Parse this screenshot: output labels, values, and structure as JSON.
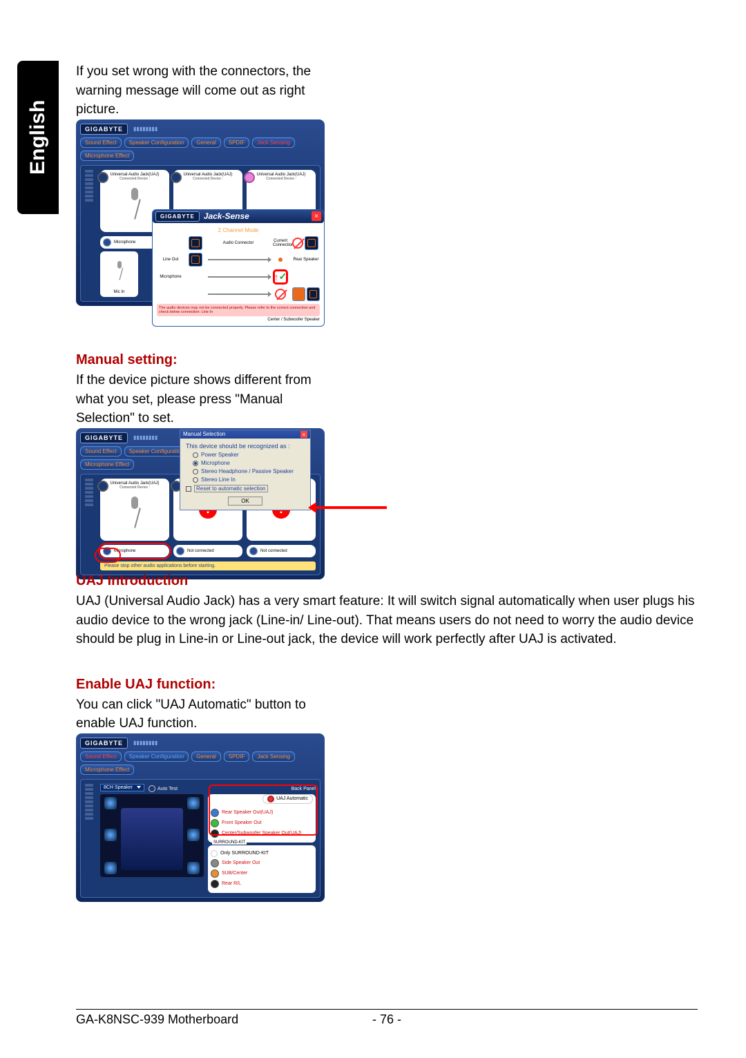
{
  "sideTab": "English",
  "section1": {
    "text": "If you set wrong with the connectors, the warning message will come out as right picture."
  },
  "section2": {
    "heading": "Manual setting:",
    "text": "If the device picture shows different from what you set, please press \"Manual Selection\" to set."
  },
  "section3": {
    "heading": "UAJ Introduction",
    "text": "UAJ (Universal Audio Jack) has a very smart feature: It will switch signal automatically when user plugs his audio device to the wrong jack (Line-in/ Line-out). That means users do not need to worry the audio device should be plug in Line-in or Line-out jack, the device will work perfectly after UAJ is activated."
  },
  "section4": {
    "heading": "Enable UAJ function:",
    "text": "You can click \"UAJ Automatic\" button to enable UAJ function."
  },
  "gigabyte": {
    "logo": "GIGABYTE",
    "tabs": {
      "soundEffect": "Sound Effect",
      "speakerConfig": "Speaker Configuration",
      "general": "General",
      "spdif": "SPDIF",
      "jackSensing": "Jack Sensing",
      "microphoneEffect": "Microphone Effect"
    }
  },
  "jacks": {
    "uaj": "Universal Audio Jack(UAJ)",
    "connected": "Connected Device :",
    "microphone": "Microphone",
    "notConnected": "Not connected",
    "micIn": "Mic In"
  },
  "jackSense": {
    "title": "Jack-Sense",
    "mode": "2 Channel Mode",
    "audioConnector": "Audio Connector",
    "currentConnection": "Current Connection",
    "lineOut": "Line Out",
    "microphone": "Microphone",
    "rearSpeaker": "Rear Speaker",
    "centerSub": "Center / Subwoofer Speaker",
    "warning": "The audio devices may not be connected properly. Please refer to the correct connection and check below connection: Line In"
  },
  "manualSelection": {
    "title": "Manual Selection",
    "prompt": "This device should be recognized as :",
    "opt1": "Power Speaker",
    "opt2": "Microphone",
    "opt3": "Stereo Headphone / Passive Speaker",
    "opt4": "Stereo Line In",
    "reset": "Reset to automatic selection",
    "ok": "OK"
  },
  "warnStrip": "Please stop other audio applications before starting.",
  "speakerCfg": {
    "dropdown": "8CH Speaker",
    "autoTest": "Auto Test",
    "backPanel": "Back Panel",
    "uajAutomatic": "UAJ Automatic",
    "rearOut": "Rear Speaker Out(UAJ)",
    "frontOut": "Front Speaker Out",
    "centerSubOut": "Center/Subwoofer Speaker Out(UAJ)",
    "surroundKit": "SURROUND-KIT",
    "onlySK": "Only SURROUND-KIT",
    "sideOut": "Side Speaker Out",
    "subCenter": "SUB/Center",
    "rearRL": "Rear R/L"
  },
  "footer": {
    "model": "GA-K8NSC-939 Motherboard",
    "page": "- 76 -"
  }
}
